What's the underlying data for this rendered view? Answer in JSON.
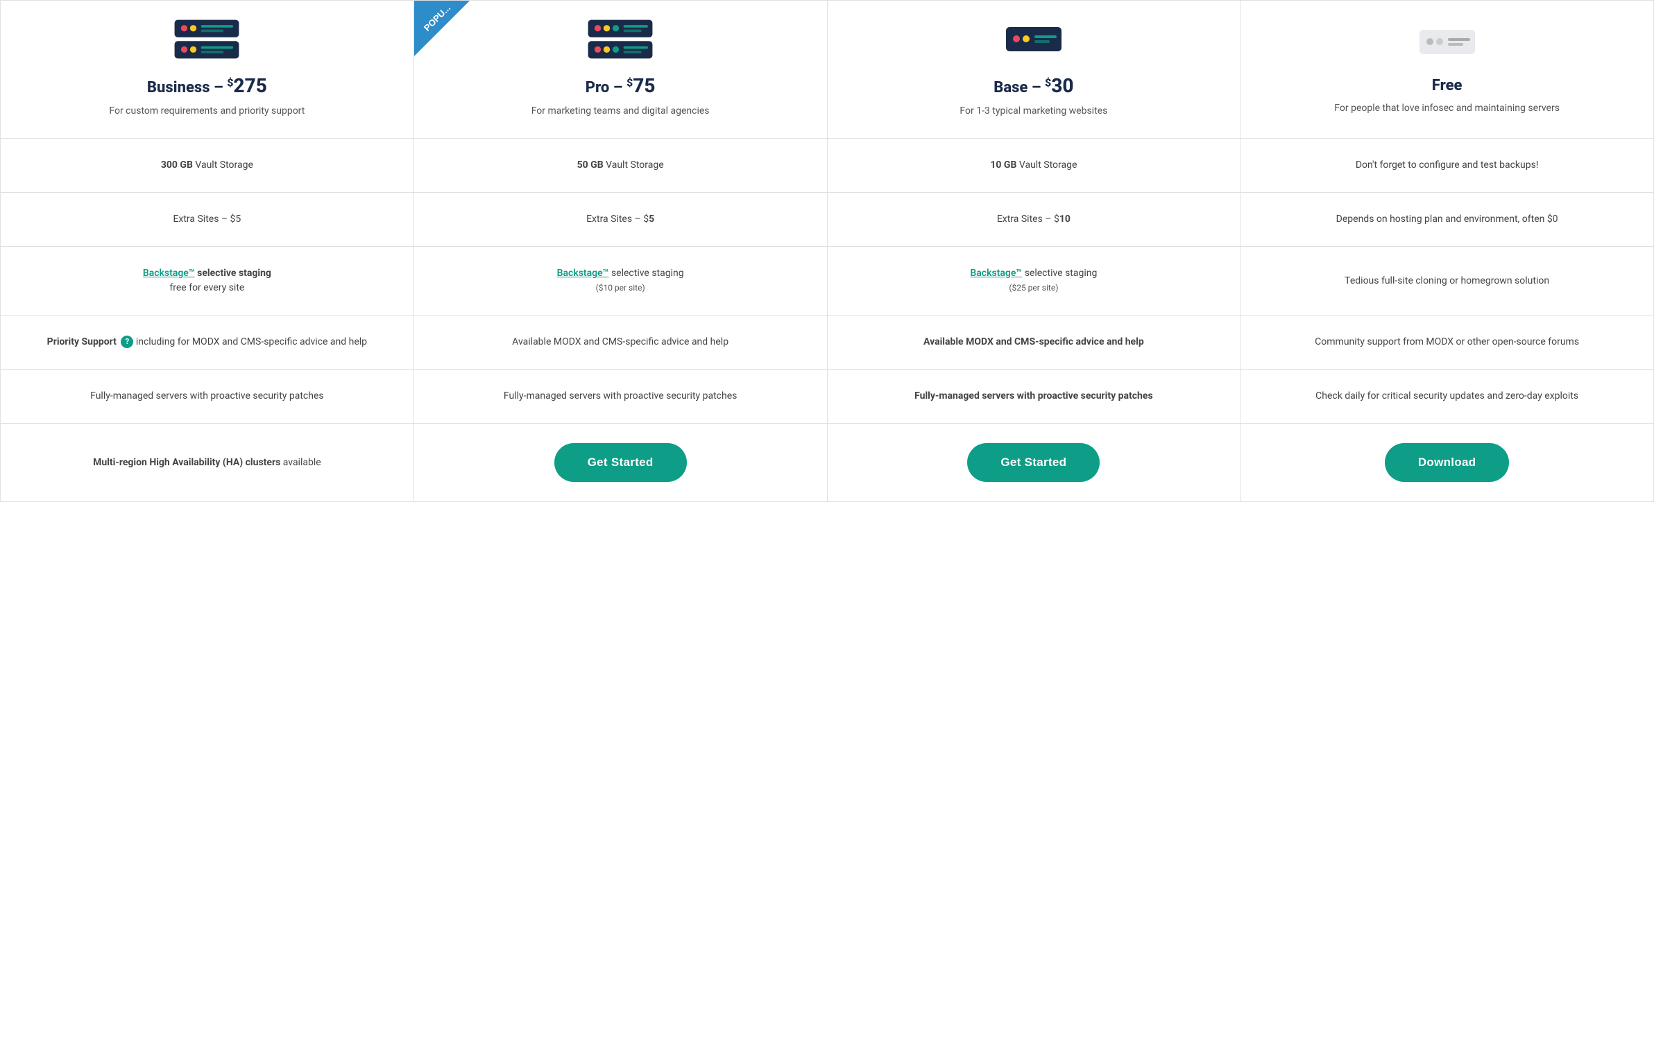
{
  "plans": [
    {
      "id": "business",
      "name": "Business",
      "price": "275",
      "desc": "For custom requirements and priority support",
      "popular": false,
      "serverStyle": "dark-dual",
      "storage": {
        "amount": "300 GB",
        "label": "Vault Storage"
      },
      "extraSites": {
        "text": "Extra Sites – $5",
        "bold": false
      },
      "staging": {
        "link": "Backstage™",
        "text": " selective staging",
        "note": "free for every site",
        "subnote": null
      },
      "support": {
        "text": "Priority Support",
        "hasHelp": true,
        "detail": " including for MODX and CMS-specific advice and help",
        "bold": true
      },
      "servers": {
        "text": "Fully-managed servers with proactive security patches",
        "bold": false
      },
      "extra": {
        "text": "Multi-region High Availability (HA) clusters available",
        "bold": true
      },
      "cta": null
    },
    {
      "id": "pro",
      "name": "Pro",
      "price": "75",
      "desc": "For marketing teams and digital agencies",
      "popular": true,
      "serverStyle": "dark-single",
      "storage": {
        "amount": "50 GB",
        "label": "Vault Storage"
      },
      "extraSites": {
        "text": "Extra Sites – $",
        "bold_part": "5",
        "bold": true
      },
      "staging": {
        "link": "Backstage™",
        "text": " selective staging",
        "note": null,
        "subnote": "($10 per site)"
      },
      "support": {
        "text": "Available MODX and CMS-specific advice and help",
        "hasHelp": false,
        "detail": null,
        "bold": false
      },
      "servers": {
        "text": "Fully-managed servers with proactive security patches",
        "bold": false
      },
      "extra": null,
      "cta": "Get Started"
    },
    {
      "id": "base",
      "name": "Base",
      "price": "30",
      "desc": "For 1-3 typical marketing websites",
      "popular": false,
      "serverStyle": "dark-small",
      "storage": {
        "amount": "10 GB",
        "label": "Vault Storage"
      },
      "extraSites": {
        "text": "Extra Sites – $10",
        "bold": false
      },
      "staging": {
        "link": "Backstage™",
        "text": " selective staging",
        "note": null,
        "subnote": "($25 per site)"
      },
      "support": {
        "text": "Available MODX and CMS-specific advice and help",
        "hasHelp": false,
        "detail": null,
        "bold": true
      },
      "servers": {
        "text": "Fully-managed servers with proactive security patches",
        "bold": true
      },
      "extra": null,
      "cta": "Get Started"
    },
    {
      "id": "free",
      "name": "Free",
      "price": null,
      "desc": "For people that love infosec and maintaining servers",
      "popular": false,
      "serverStyle": "light-small",
      "storage": {
        "amount": null,
        "label": "Don't forget to configure and test backups!"
      },
      "extraSites": {
        "text": "Depends on hosting plan and environment, often $0",
        "bold": false
      },
      "staging": {
        "link": null,
        "text": "Tedious full-site cloning or homegrown solution",
        "note": null,
        "subnote": null
      },
      "support": {
        "text": "Community support from MODX or other open-source forums",
        "hasHelp": false,
        "detail": null,
        "bold": false
      },
      "servers": {
        "text": "Check daily for critical security updates and zero-day exploits",
        "bold": false
      },
      "extra": null,
      "cta": "Download"
    }
  ]
}
